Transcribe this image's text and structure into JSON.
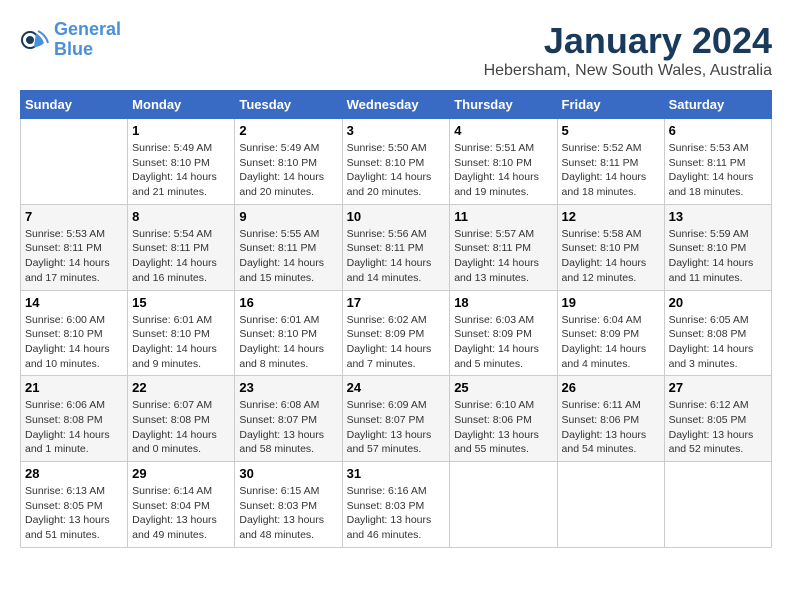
{
  "logo": {
    "line1": "General",
    "line2": "Blue"
  },
  "title": "January 2024",
  "location": "Hebersham, New South Wales, Australia",
  "weekdays": [
    "Sunday",
    "Monday",
    "Tuesday",
    "Wednesday",
    "Thursday",
    "Friday",
    "Saturday"
  ],
  "weeks": [
    [
      {
        "day": "",
        "info": ""
      },
      {
        "day": "1",
        "info": "Sunrise: 5:49 AM\nSunset: 8:10 PM\nDaylight: 14 hours\nand 21 minutes."
      },
      {
        "day": "2",
        "info": "Sunrise: 5:49 AM\nSunset: 8:10 PM\nDaylight: 14 hours\nand 20 minutes."
      },
      {
        "day": "3",
        "info": "Sunrise: 5:50 AM\nSunset: 8:10 PM\nDaylight: 14 hours\nand 20 minutes."
      },
      {
        "day": "4",
        "info": "Sunrise: 5:51 AM\nSunset: 8:10 PM\nDaylight: 14 hours\nand 19 minutes."
      },
      {
        "day": "5",
        "info": "Sunrise: 5:52 AM\nSunset: 8:11 PM\nDaylight: 14 hours\nand 18 minutes."
      },
      {
        "day": "6",
        "info": "Sunrise: 5:53 AM\nSunset: 8:11 PM\nDaylight: 14 hours\nand 18 minutes."
      }
    ],
    [
      {
        "day": "7",
        "info": "Sunrise: 5:53 AM\nSunset: 8:11 PM\nDaylight: 14 hours\nand 17 minutes."
      },
      {
        "day": "8",
        "info": "Sunrise: 5:54 AM\nSunset: 8:11 PM\nDaylight: 14 hours\nand 16 minutes."
      },
      {
        "day": "9",
        "info": "Sunrise: 5:55 AM\nSunset: 8:11 PM\nDaylight: 14 hours\nand 15 minutes."
      },
      {
        "day": "10",
        "info": "Sunrise: 5:56 AM\nSunset: 8:11 PM\nDaylight: 14 hours\nand 14 minutes."
      },
      {
        "day": "11",
        "info": "Sunrise: 5:57 AM\nSunset: 8:11 PM\nDaylight: 14 hours\nand 13 minutes."
      },
      {
        "day": "12",
        "info": "Sunrise: 5:58 AM\nSunset: 8:10 PM\nDaylight: 14 hours\nand 12 minutes."
      },
      {
        "day": "13",
        "info": "Sunrise: 5:59 AM\nSunset: 8:10 PM\nDaylight: 14 hours\nand 11 minutes."
      }
    ],
    [
      {
        "day": "14",
        "info": "Sunrise: 6:00 AM\nSunset: 8:10 PM\nDaylight: 14 hours\nand 10 minutes."
      },
      {
        "day": "15",
        "info": "Sunrise: 6:01 AM\nSunset: 8:10 PM\nDaylight: 14 hours\nand 9 minutes."
      },
      {
        "day": "16",
        "info": "Sunrise: 6:01 AM\nSunset: 8:10 PM\nDaylight: 14 hours\nand 8 minutes."
      },
      {
        "day": "17",
        "info": "Sunrise: 6:02 AM\nSunset: 8:09 PM\nDaylight: 14 hours\nand 7 minutes."
      },
      {
        "day": "18",
        "info": "Sunrise: 6:03 AM\nSunset: 8:09 PM\nDaylight: 14 hours\nand 5 minutes."
      },
      {
        "day": "19",
        "info": "Sunrise: 6:04 AM\nSunset: 8:09 PM\nDaylight: 14 hours\nand 4 minutes."
      },
      {
        "day": "20",
        "info": "Sunrise: 6:05 AM\nSunset: 8:08 PM\nDaylight: 14 hours\nand 3 minutes."
      }
    ],
    [
      {
        "day": "21",
        "info": "Sunrise: 6:06 AM\nSunset: 8:08 PM\nDaylight: 14 hours\nand 1 minute."
      },
      {
        "day": "22",
        "info": "Sunrise: 6:07 AM\nSunset: 8:08 PM\nDaylight: 14 hours\nand 0 minutes."
      },
      {
        "day": "23",
        "info": "Sunrise: 6:08 AM\nSunset: 8:07 PM\nDaylight: 13 hours\nand 58 minutes."
      },
      {
        "day": "24",
        "info": "Sunrise: 6:09 AM\nSunset: 8:07 PM\nDaylight: 13 hours\nand 57 minutes."
      },
      {
        "day": "25",
        "info": "Sunrise: 6:10 AM\nSunset: 8:06 PM\nDaylight: 13 hours\nand 55 minutes."
      },
      {
        "day": "26",
        "info": "Sunrise: 6:11 AM\nSunset: 8:06 PM\nDaylight: 13 hours\nand 54 minutes."
      },
      {
        "day": "27",
        "info": "Sunrise: 6:12 AM\nSunset: 8:05 PM\nDaylight: 13 hours\nand 52 minutes."
      }
    ],
    [
      {
        "day": "28",
        "info": "Sunrise: 6:13 AM\nSunset: 8:05 PM\nDaylight: 13 hours\nand 51 minutes."
      },
      {
        "day": "29",
        "info": "Sunrise: 6:14 AM\nSunset: 8:04 PM\nDaylight: 13 hours\nand 49 minutes."
      },
      {
        "day": "30",
        "info": "Sunrise: 6:15 AM\nSunset: 8:03 PM\nDaylight: 13 hours\nand 48 minutes."
      },
      {
        "day": "31",
        "info": "Sunrise: 6:16 AM\nSunset: 8:03 PM\nDaylight: 13 hours\nand 46 minutes."
      },
      {
        "day": "",
        "info": ""
      },
      {
        "day": "",
        "info": ""
      },
      {
        "day": "",
        "info": ""
      }
    ]
  ]
}
